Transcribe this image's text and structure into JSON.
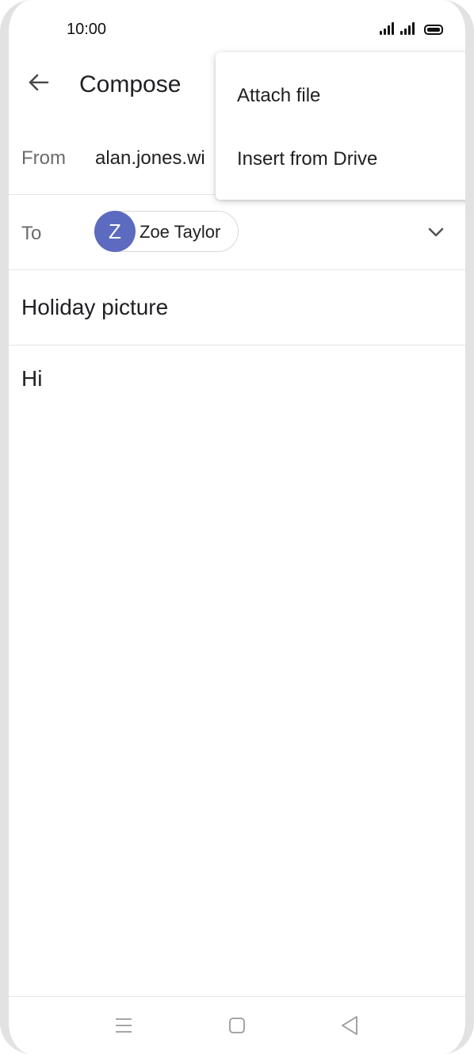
{
  "status_bar": {
    "time": "10:00"
  },
  "app_bar": {
    "title": "Compose",
    "back_icon": "arrow-left-icon"
  },
  "compose": {
    "from_label": "From",
    "from_value": "alan.jones.wi",
    "to_label": "To",
    "recipient": {
      "initial": "Z",
      "name": "Zoe Taylor",
      "avatar_color": "#5c6bc0"
    },
    "expand_icon": "chevron-down-icon",
    "subject": "Holiday picture",
    "body": "Hi"
  },
  "attach_menu": {
    "items": [
      {
        "label": "Attach file"
      },
      {
        "label": "Insert from Drive"
      }
    ]
  },
  "nav_bar": {
    "icons": [
      "menu-icon",
      "home-icon",
      "back-triangle-icon"
    ]
  }
}
